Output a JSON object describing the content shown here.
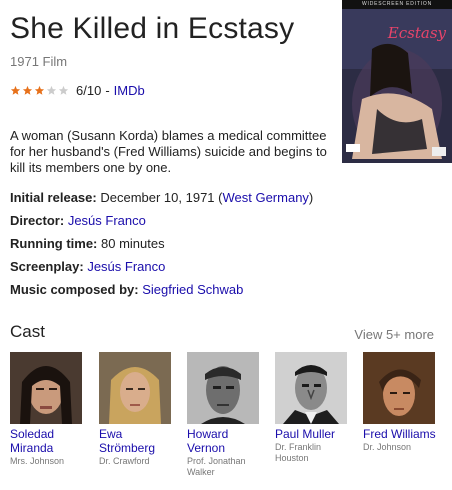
{
  "header": {
    "title": "She Killed in Ecstasy",
    "subtitle": "1971 Film"
  },
  "rating": {
    "stars_filled": 3,
    "stars_total": 5,
    "score": "6/10",
    "separator": "-",
    "source": "IMDb",
    "star_color": "#e7711b",
    "star_empty_color": "#ccc"
  },
  "poster": {
    "top_text": "WIDESCREEN EDITION",
    "logo_text": "Ecstasy"
  },
  "description": "A woman (Susann Korda) blames a medical committee for her husband's (Fred Williams) suicide and begins to kill its members one by one.",
  "facts": [
    {
      "label": "Initial release:",
      "value": "December 10, 1971 (",
      "link": "West Germany",
      "suffix": ")"
    },
    {
      "label": "Director:",
      "value": "",
      "link": "Jesús Franco",
      "suffix": ""
    },
    {
      "label": "Running time:",
      "value": "80 minutes",
      "link": "",
      "suffix": ""
    },
    {
      "label": "Screenplay:",
      "value": "",
      "link": "Jesús Franco",
      "suffix": ""
    },
    {
      "label": "Music composed by:",
      "value": "",
      "link": "Siegfried Schwab",
      "suffix": ""
    }
  ],
  "cast": {
    "title": "Cast",
    "view_more": "View 5+ more",
    "members": [
      {
        "name": "Soledad Miranda",
        "role": "Mrs. Johnson"
      },
      {
        "name": "Ewa Strömberg",
        "role": "Dr. Crawford"
      },
      {
        "name": "Howard Vernon",
        "role": "Prof. Jonathan Walker"
      },
      {
        "name": "Paul Muller",
        "role": "Dr. Franklin Houston"
      },
      {
        "name": "Fred Williams",
        "role": "Dr. Johnson"
      }
    ]
  },
  "colors": {
    "link": "#1a0dab",
    "muted": "#777777",
    "text": "#222222"
  }
}
